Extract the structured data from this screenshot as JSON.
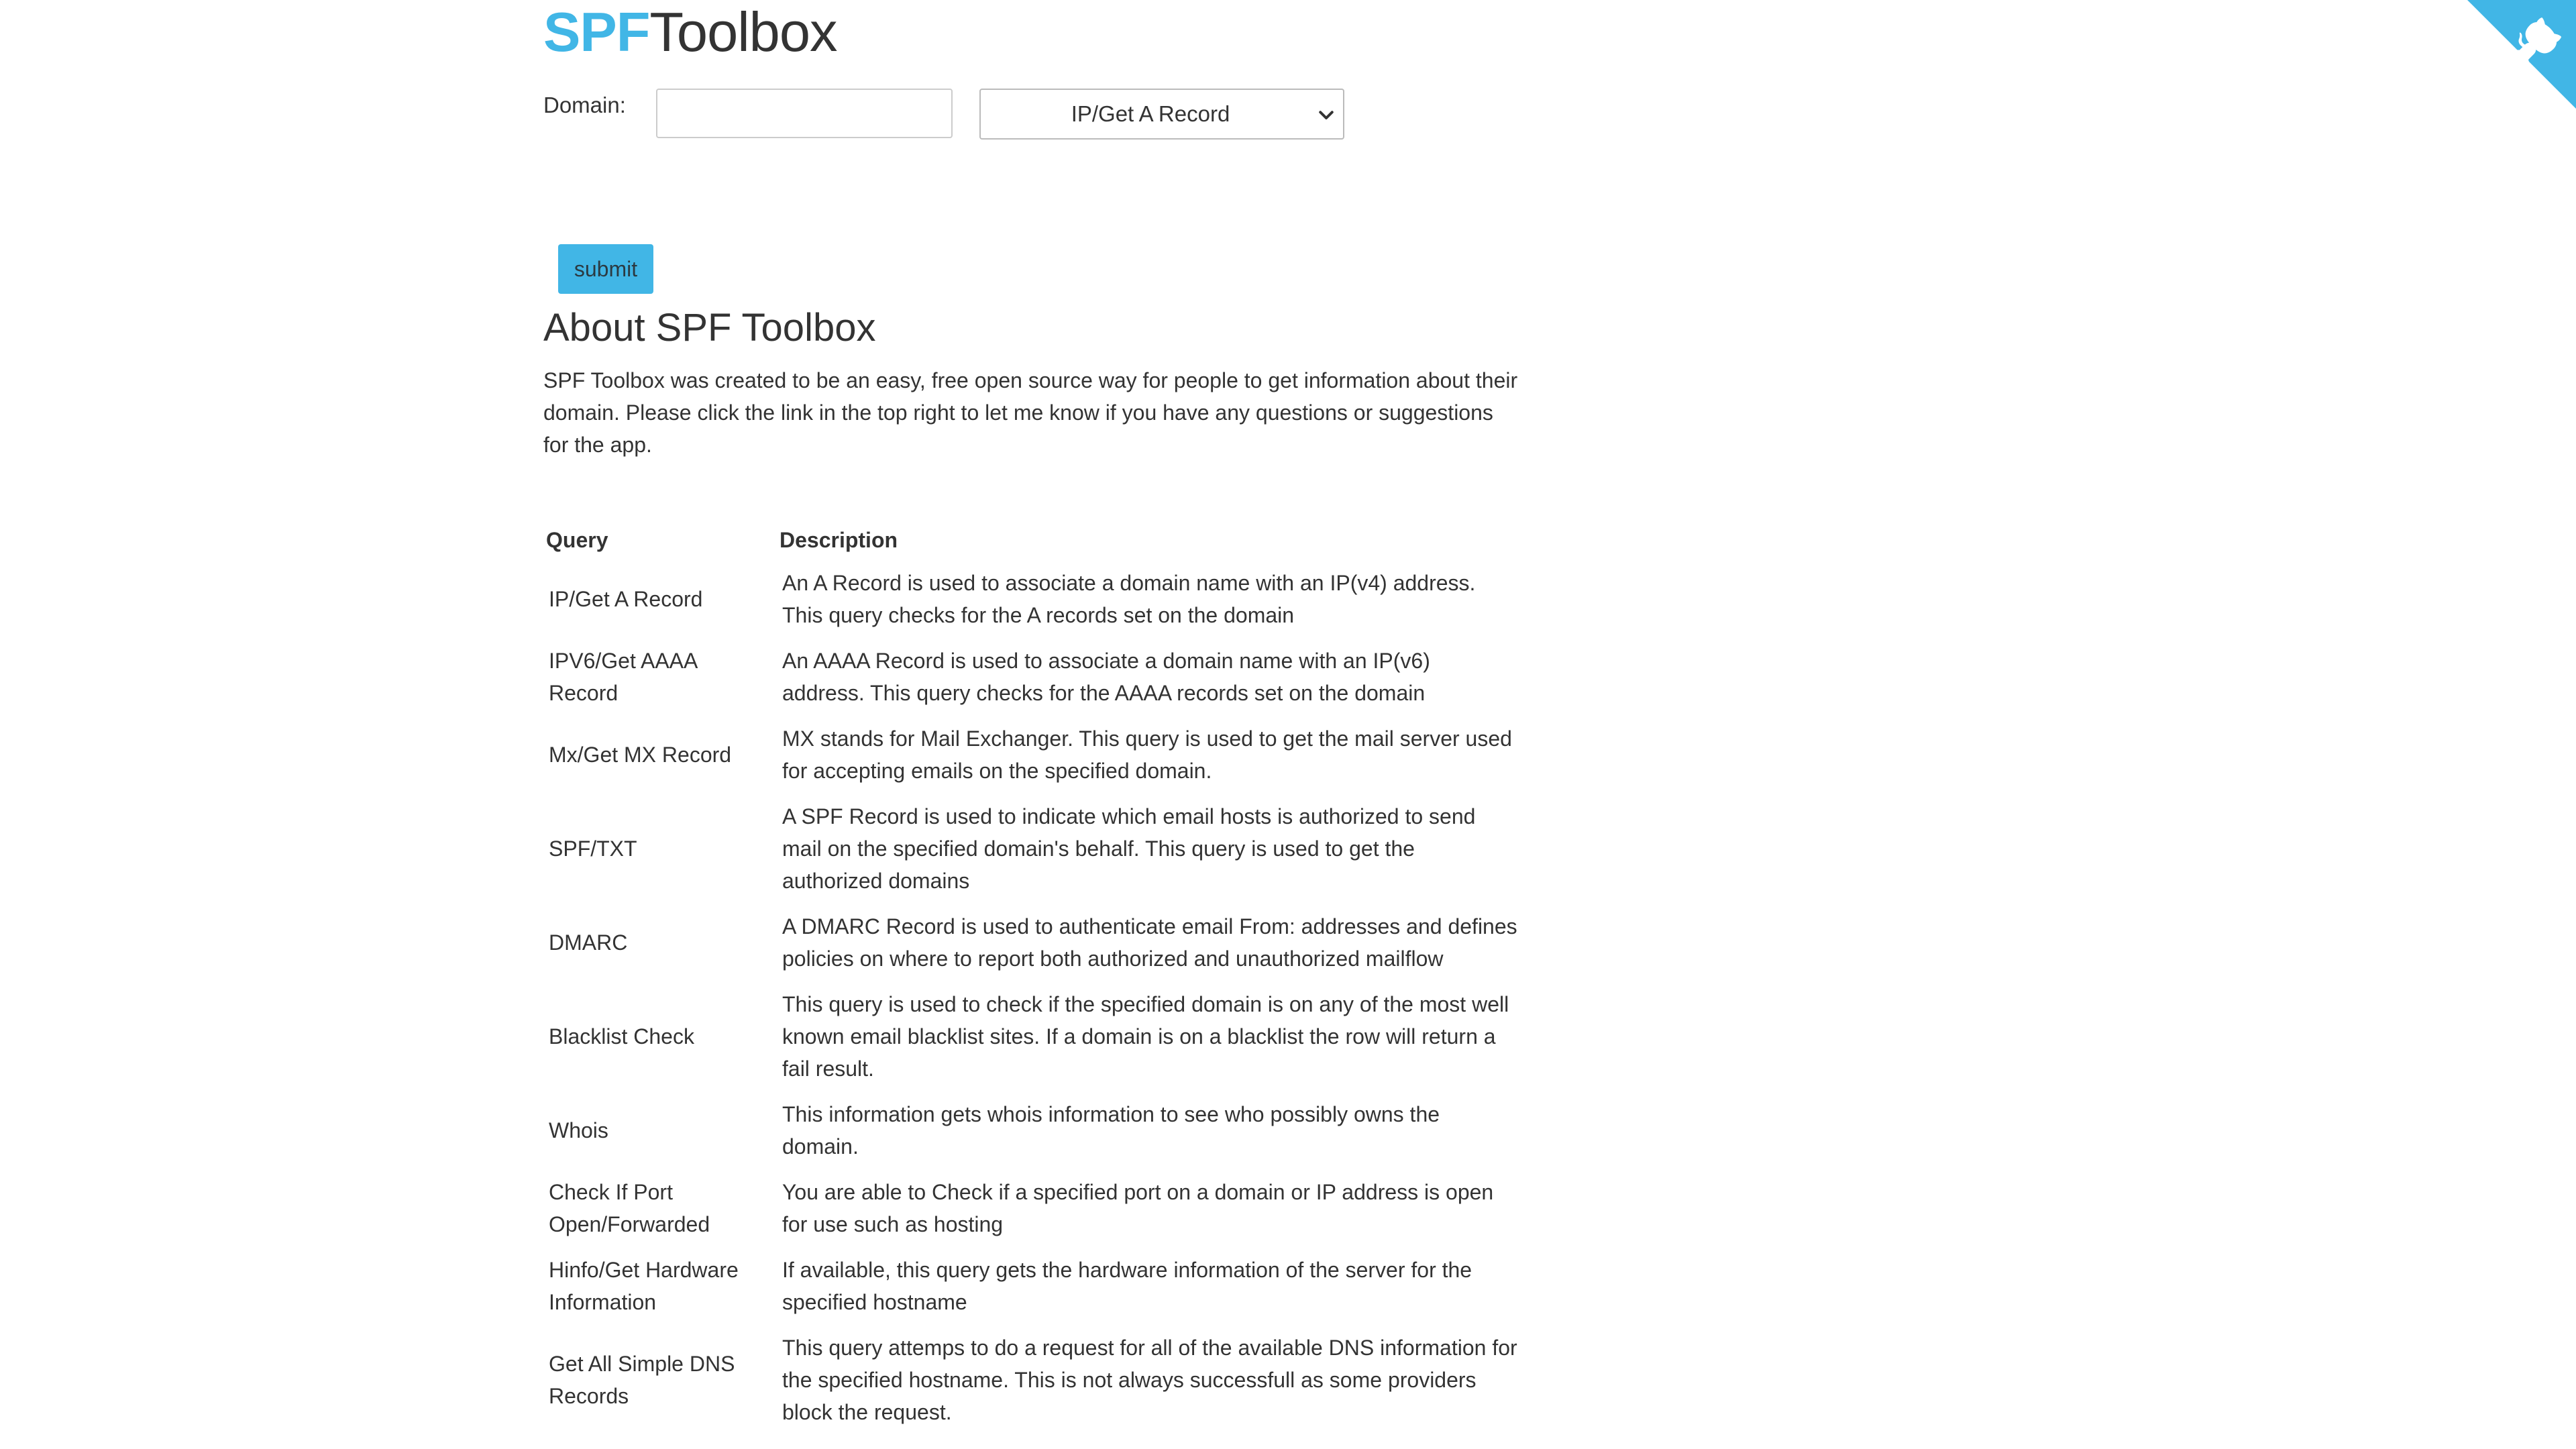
{
  "header": {
    "logo_accent": "SPF",
    "logo_rest": "Toolbox"
  },
  "form": {
    "domain_label": "Domain:",
    "domain_value": "",
    "select_value": "IP/Get A Record",
    "submit_label": "submit"
  },
  "about": {
    "heading": "About SPF Toolbox",
    "text": "SPF Toolbox was created to be an easy, free open source way for people to get information about their domain. Please click the link in the top right to let me know if you have any questions or suggestions for the app."
  },
  "table": {
    "headers": {
      "query": "Query",
      "description": "Description"
    },
    "rows": [
      {
        "query": "IP/Get A Record",
        "description": "An A Record is used to associate a domain name with an IP(v4) address. This query checks for the A records set on the domain"
      },
      {
        "query": "IPV6/Get AAAA Record",
        "description": "An AAAA Record is used to associate a domain name with an IP(v6) address. This query checks for the AAAA records set on the domain"
      },
      {
        "query": "Mx/Get MX Record",
        "description": "MX stands for Mail Exchanger. This query is used to get the mail server used for accepting emails on the specified domain."
      },
      {
        "query": "SPF/TXT",
        "description": "A SPF Record is used to indicate which email hosts is authorized to send mail on the specified domain's behalf. This query is used to get the authorized domains"
      },
      {
        "query": "DMARC",
        "description": "A DMARC Record is used to authenticate email From: addresses and defines policies on where to report both authorized and unauthorized mailflow"
      },
      {
        "query": "Blacklist Check",
        "description": "This query is used to check if the specified domain is on any of the most well known email blacklist sites. If a domain is on a blacklist the row will return a fail result."
      },
      {
        "query": "Whois",
        "description": "This information gets whois information to see who possibly owns the domain."
      },
      {
        "query": "Check If Port Open/Forwarded",
        "description": "You are able to Check if a specified port on a domain or IP address is open for use such as hosting"
      },
      {
        "query": "Hinfo/Get Hardware Information",
        "description": "If available, this query gets the hardware information of the server for the specified hostname"
      },
      {
        "query": "Get All Simple DNS Records",
        "description": "This query attemps to do a request for all of the available DNS information for the specified hostname. This is not always successfull as some providers block the request."
      }
    ]
  },
  "icons": {
    "corner_ribbon": "github-octocat-icon",
    "select_arrow": "chevron-down-icon"
  },
  "colors": {
    "accent": "#41b6e6",
    "text": "#333333",
    "button_text": "#2b3a42"
  }
}
